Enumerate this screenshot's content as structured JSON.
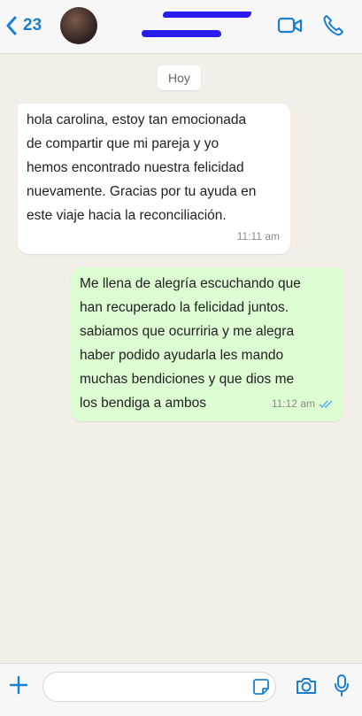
{
  "header": {
    "back_count": "23",
    "contact_name": "",
    "contact_status": ""
  },
  "chat": {
    "date_label": "Hoy",
    "messages": [
      {
        "direction": "incoming",
        "text": " hola carolina, estoy tan emocionada\nde compartir que mi pareja y yo\nhemos encontrado nuestra felicidad\nnuevamente. Gracias por tu ayuda en\neste viaje hacia la reconciliación.",
        "time": "11:11 am"
      },
      {
        "direction": "outgoing",
        "text": " Me llena de alegría escuchando que\nhan recuperado la felicidad juntos.\nsabiamos que ocurriria y me alegra\nhaber podido ayudarla les mando\nmuchas bendiciones y que dios me\nlos bendiga a ambos",
        "time": "11:12 am",
        "read_status": "double-check-read"
      }
    ]
  },
  "composer": {
    "placeholder": "",
    "value": ""
  },
  "colors": {
    "accent": "#1a7fd1",
    "outgoing_bubble": "#dcfcd2",
    "incoming_bubble": "#ffffff",
    "chat_background": "#f4eee9",
    "redaction": "#2a1bef",
    "read_ticks": "#4fb3f0"
  },
  "icons": [
    "chevron-left-icon",
    "video-call-icon",
    "phone-icon",
    "plus-icon",
    "sticker-icon",
    "camera-icon",
    "microphone-icon",
    "double-check-icon"
  ]
}
